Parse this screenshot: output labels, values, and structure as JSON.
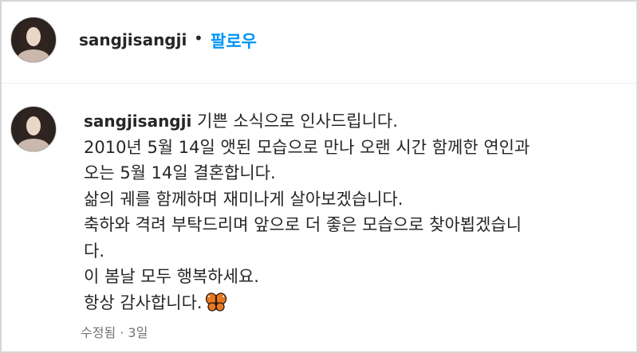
{
  "header": {
    "username": "sangjisangji",
    "separator": "•",
    "follow_label": "팔로우"
  },
  "comment": {
    "username": "sangjisangji",
    "lines": [
      "기쁜 소식으로 인사드립니다.",
      "2010년 5월 14일 앳된 모습으로 만나 오랜 시간 함께한 연인과",
      "오는 5월 14일 결혼합니다.",
      "삶의 궤를 함께하며 재미나게 살아보겠습니다.",
      "축하와 격려 부탁드리며 앞으로 더 좋은 모습으로 찾아뵙겠습니",
      "다.",
      "이 봄날 모두 행복하세요.",
      "항상 감사합니다."
    ],
    "emoji": "butterfly",
    "meta": "수정됨 · 3일"
  },
  "colors": {
    "follow": "#0095f6",
    "text": "#262626",
    "meta": "#737373",
    "butterfly": "#e8791e"
  }
}
